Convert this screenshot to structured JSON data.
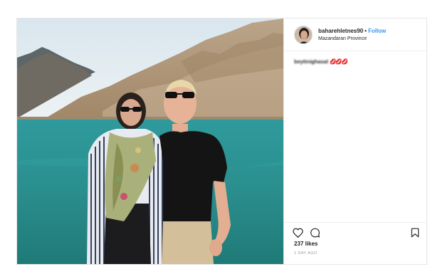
{
  "post": {
    "username": "baharehletnes90",
    "separator": "•",
    "follow_label": "Follow",
    "location": "Mazandaran Province",
    "comment_user": "beytinighasal",
    "comment_text": "💋💋💋",
    "likes": "237 likes",
    "timestamp": "1 DAY AGO"
  },
  "icons": {
    "like": "heart-icon",
    "comment": "comment-icon",
    "save": "bookmark-icon"
  },
  "colors": {
    "follow": "#3897f0",
    "lake": "#2b8f8f",
    "mountain": "#b59b7a"
  }
}
